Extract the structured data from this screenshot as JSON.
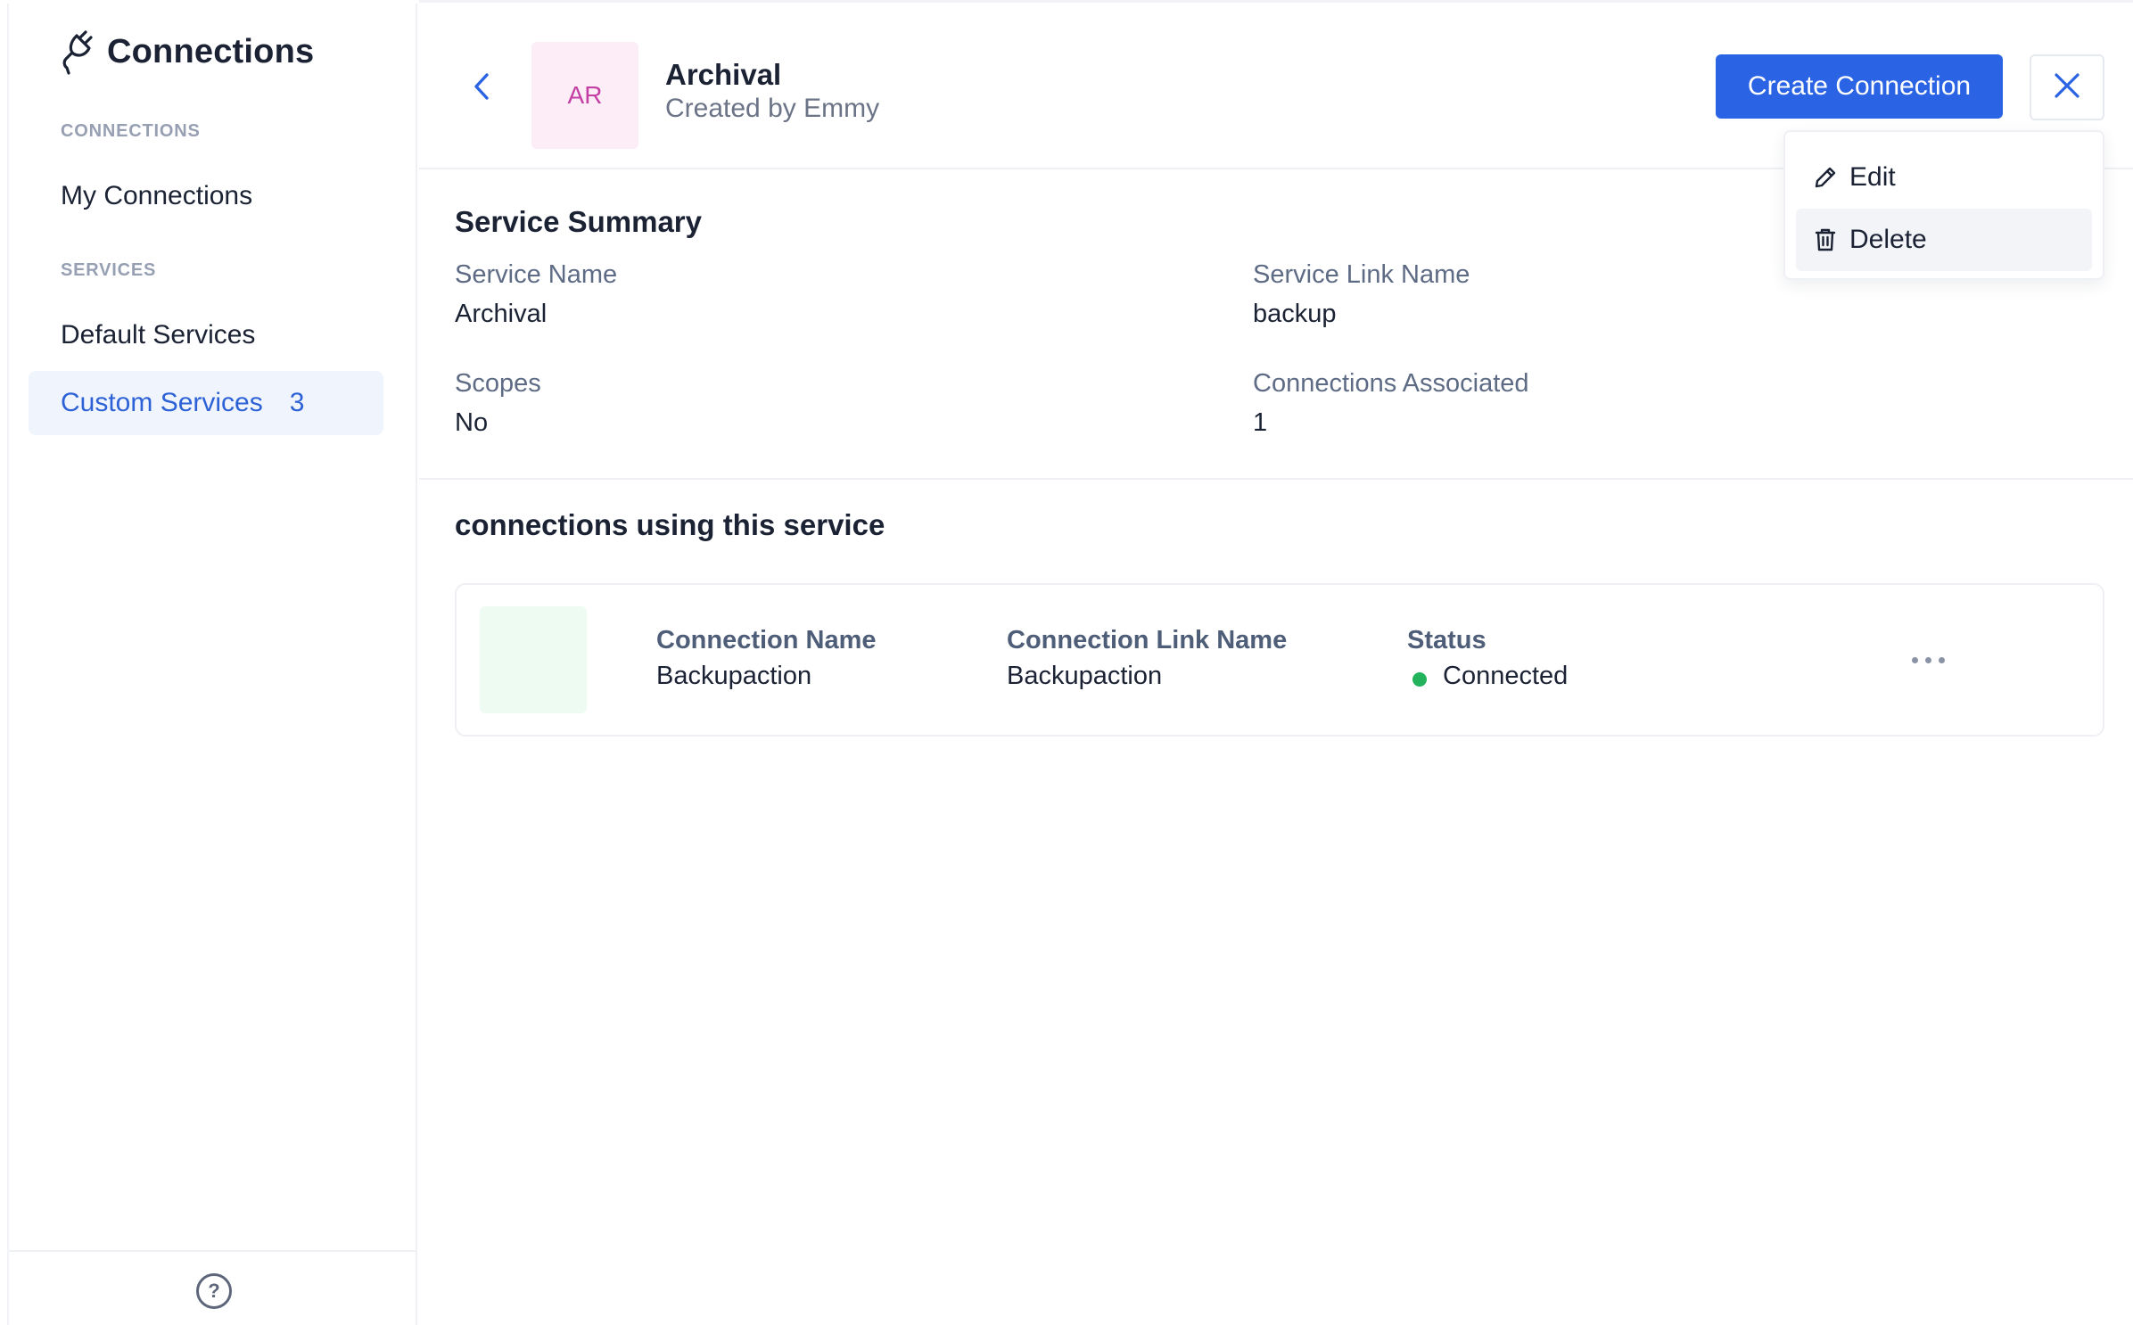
{
  "sidebar": {
    "title": "Connections",
    "title_icon": "plug-icon",
    "sections": [
      {
        "label": "CONNECTIONS"
      },
      {
        "label": "SERVICES"
      }
    ],
    "items": [
      {
        "label": "My Connections"
      },
      {
        "label": "Default Services"
      },
      {
        "label": "Custom Services",
        "count": "3",
        "active": true
      }
    ],
    "help_icon": "?"
  },
  "header": {
    "avatar_initials": "AR",
    "title": "Archival",
    "subtitle": "Created by Emmy",
    "create_button": "Create Connection"
  },
  "dropdown": {
    "items": [
      {
        "label": "Edit",
        "icon": "pencil-icon"
      },
      {
        "label": "Delete",
        "icon": "trash-icon"
      }
    ]
  },
  "summary": {
    "title": "Service Summary",
    "fields": [
      {
        "label": "Service Name",
        "value": "Archival"
      },
      {
        "label": "Service Link Name",
        "value": "backup"
      },
      {
        "label": "Scopes",
        "value": "No"
      },
      {
        "label": "Connections Associated",
        "value": "1"
      }
    ]
  },
  "connections": {
    "title": "connections using this service",
    "columns": [
      "Connection Name",
      "Connection Link Name",
      "Status"
    ],
    "rows": [
      {
        "name": "Backupaction",
        "link_name": "Backupaction",
        "status": "Connected"
      }
    ]
  },
  "colors": {
    "accent": "#2a63e3",
    "status_connected": "#22b35c",
    "avatar_bg": "#fcedf6",
    "avatar_text": "#c43fa4"
  }
}
